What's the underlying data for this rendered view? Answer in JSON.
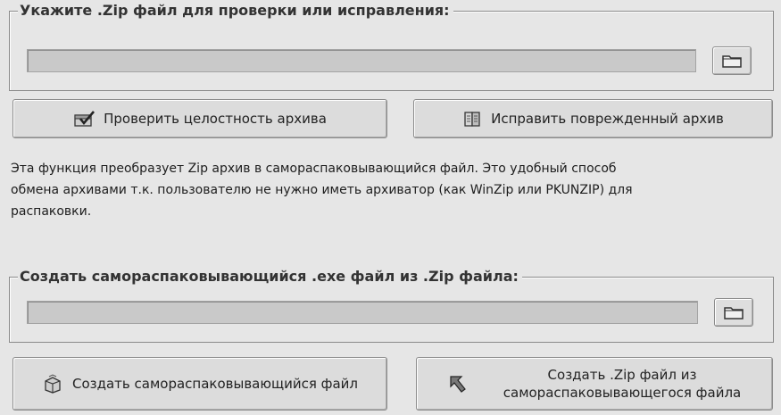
{
  "check_section": {
    "title": "Укажите .Zip файл для проверки или исправления:",
    "path_value": "",
    "browse_icon": "folder-icon"
  },
  "actions_top": {
    "verify_label": "Проверить целостность архива",
    "verify_icon": "check-archive-icon",
    "repair_label": "Исправить поврежденный архив",
    "repair_icon": "repair-book-icon"
  },
  "description": {
    "line1": "Эта функция преобразует Zip архив в самораспаковывающийся файл. Это удобный способ",
    "line2": "обмена архивами т.к. пользователю не нужно иметь архиватор (как WinZip или PKUNZIP) для",
    "line3": "распаковки."
  },
  "sfx_section": {
    "title": "Создать самораспаковывающийся .exe файл из .Zip файла:",
    "path_value": "",
    "browse_icon": "folder-icon"
  },
  "actions_bottom": {
    "create_sfx_label": "Создать самораспаковывающийся файл",
    "create_sfx_icon": "package-icon",
    "create_zip_line1": "Создать .Zip файл из",
    "create_zip_line2": "самораспаковывающегося файла",
    "create_zip_icon": "arrow-back-icon"
  }
}
